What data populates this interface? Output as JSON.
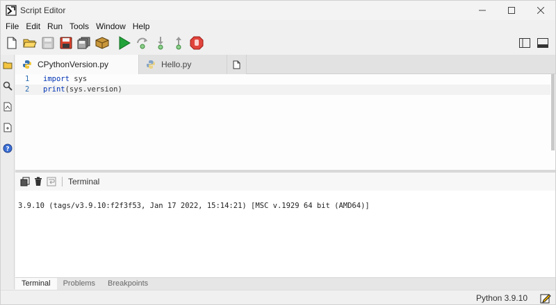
{
  "window": {
    "title": "Script Editor"
  },
  "menu": {
    "items": [
      "File",
      "Edit",
      "Run",
      "Tools",
      "Window",
      "Help"
    ]
  },
  "toolbar": {
    "buttons": [
      "new-file-icon",
      "open-folder-icon",
      "save-icon",
      "save-as-icon",
      "save-all-icon",
      "package-icon",
      "run-icon",
      "step-over-icon",
      "step-into-icon",
      "step-out-icon",
      "stop-icon"
    ],
    "right_buttons": [
      "toggle-sidebar-icon",
      "toggle-bottom-panel-icon"
    ]
  },
  "leftbar": {
    "buttons": [
      "folder-icon",
      "search-icon",
      "document-icon",
      "script-icon",
      "help-icon"
    ]
  },
  "tabs": [
    {
      "label": "CPythonVersion.py",
      "active": true
    },
    {
      "label": "Hello.py",
      "active": false
    }
  ],
  "editor": {
    "lines": [
      {
        "no": "1",
        "keyword": "import",
        "rest": " sys"
      },
      {
        "no": "2",
        "keyword": "print",
        "rest": "(sys.version)"
      }
    ]
  },
  "terminal_panel": {
    "label": "Terminal",
    "output": "3.9.10 (tags/v3.9.10:f2f3f53, Jan 17 2022, 15:14:21) [MSC v.1929 64 bit (AMD64)]"
  },
  "bottom_tabs": [
    {
      "label": "Terminal",
      "active": true
    },
    {
      "label": "Problems",
      "active": false
    },
    {
      "label": "Breakpoints",
      "active": false
    }
  ],
  "status": {
    "interpreter": "Python 3.9.10"
  },
  "colors": {
    "accent_blue": "#2b6cb0",
    "run_green": "#22a33a",
    "stop_red": "#e0443c"
  }
}
